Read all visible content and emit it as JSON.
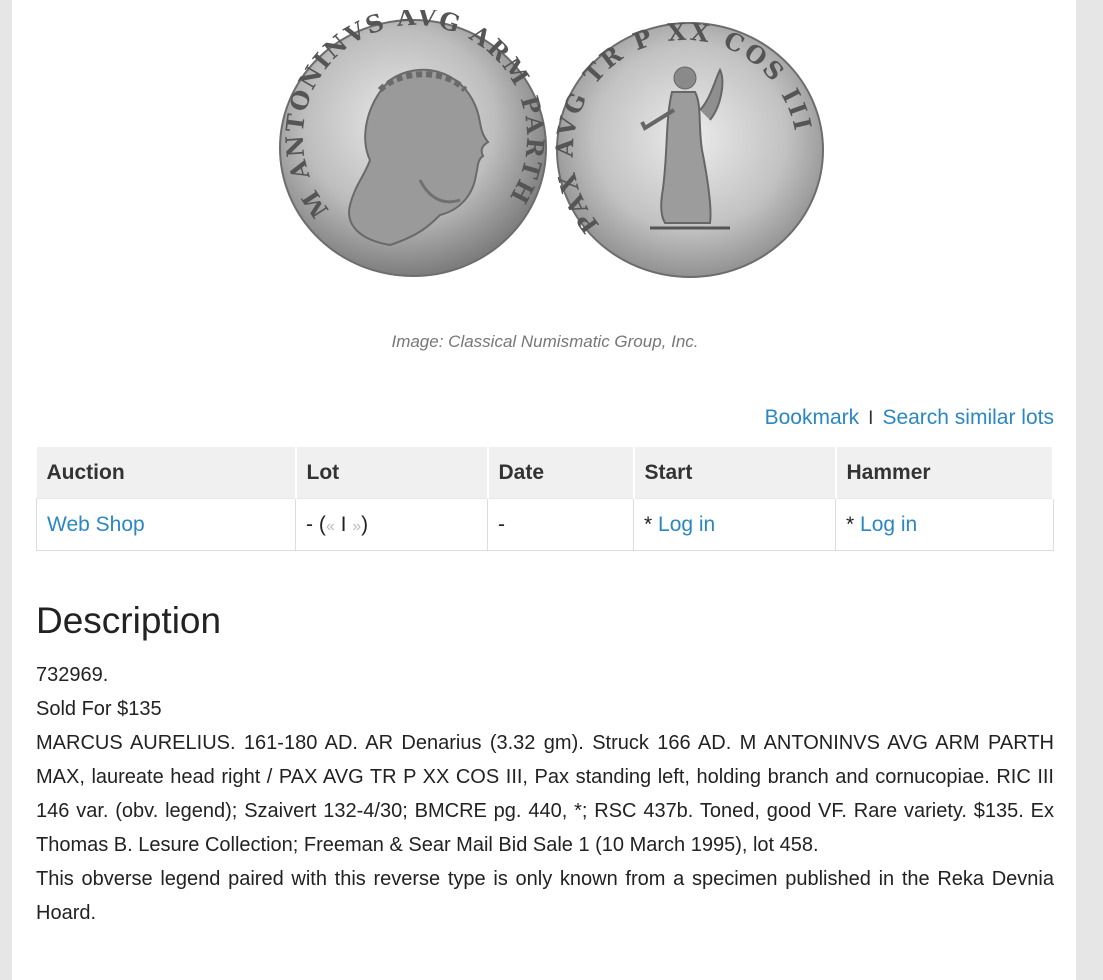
{
  "image_caption": "Image: Classical Numismatic Group, Inc.",
  "coin_legends": {
    "obverse": "M ANTONINVS AVG ARM PARTH MAX",
    "reverse": "PAX AVG TR P XX COS III"
  },
  "actions": {
    "bookmark": "Bookmark",
    "separator": "I",
    "search_similar": "Search similar lots"
  },
  "table": {
    "headers": [
      "Auction",
      "Lot",
      "Date",
      "Start",
      "Hammer"
    ],
    "row": {
      "auction": "Web Shop",
      "lot_prefix": "- (",
      "lot_prev": "«",
      "lot_sep": "I",
      "lot_next": "»",
      "lot_suffix": ")",
      "date": "-",
      "start_prefix": "* ",
      "start_link": "Log in",
      "hammer_prefix": "* ",
      "hammer_link": "Log in"
    }
  },
  "description": {
    "title": "Description",
    "lot_id": "732969.",
    "sold": "Sold For $135",
    "text1": "MARCUS AURELIUS. 161-180 AD. AR Denarius (3.32 gm). Struck 166 AD. M ANTONINVS AVG ARM PARTH MAX, laureate head right / PAX AVG TR P XX COS III, Pax standing left, holding branch and cornucopiae. RIC III 146 var. (obv. legend); Szaivert 132-4/30; BMCRE pg. 440, *; RSC 437b. Toned, good VF. Rare variety. $135. Ex Thomas B. Lesure Collection; Freeman & Sear Mail Bid Sale 1 (10 March 1995), lot 458.",
    "text2": "This obverse legend paired with this reverse type is only known from a specimen published in the Reka Devnia Hoard."
  },
  "colors": {
    "link": "#2a87c4",
    "header_bg": "#f0f0f0",
    "page_bg": "#e6e6e6"
  }
}
